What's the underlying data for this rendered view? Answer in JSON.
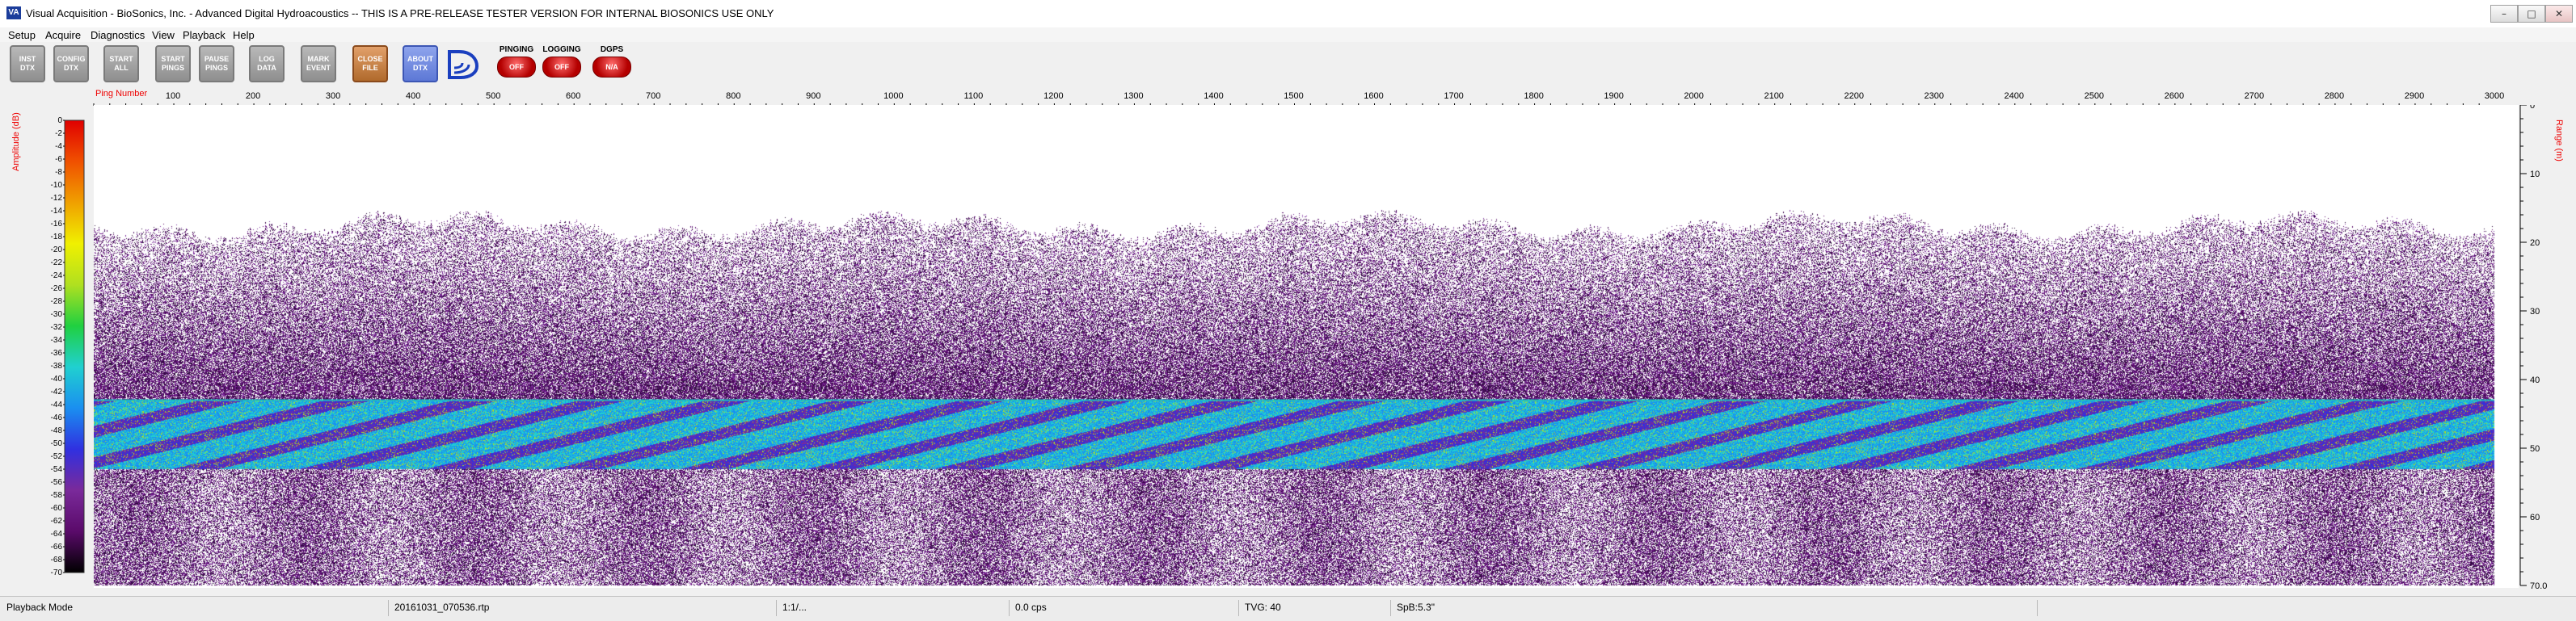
{
  "window": {
    "app_icon_text": "VA",
    "title": "Visual Acquisition  -  BioSonics, Inc.  -  Advanced Digital Hydroacoustics  --  THIS IS A PRE-RELEASE TESTER VERSION FOR INTERNAL BIOSONICS USE ONLY",
    "controls": {
      "minimize": "–",
      "maximize": "□",
      "close": "✕"
    }
  },
  "menu": {
    "items": [
      {
        "label": "Setup"
      },
      {
        "label": "Acquire"
      },
      {
        "label": "Diagnostics"
      },
      {
        "label": "View"
      },
      {
        "label": "Playback"
      },
      {
        "label": "Help"
      }
    ]
  },
  "toolbar": {
    "buttons": [
      {
        "label": "INST\nDTX",
        "style": "gray"
      },
      {
        "label": "CONFIG\nDTX",
        "style": "gray"
      },
      {
        "label": "START\nALL",
        "style": "gray"
      },
      {
        "label": "START\nPINGS",
        "style": "gray"
      },
      {
        "label": "PAUSE\nPINGS",
        "style": "gray"
      },
      {
        "label": "LOG\nDATA",
        "style": "gray"
      },
      {
        "label": "MARK\nEVENT",
        "style": "gray"
      },
      {
        "label": "CLOSE\nFILE",
        "style": "orange"
      },
      {
        "label": "ABOUT\nDTX",
        "style": "blue"
      }
    ],
    "logo_icon": "biosonics-logo-icon",
    "status": [
      {
        "label": "PINGING",
        "value": "OFF"
      },
      {
        "label": "LOGGING",
        "value": "OFF"
      },
      {
        "label": "DGPS",
        "value": "N/A"
      }
    ]
  },
  "axes": {
    "amplitude_title": "Amplitude (dB)",
    "range_title": "Range (m)",
    "ping_title": "Ping Number",
    "colorbar_ticks": [
      "0",
      "-2",
      "-4",
      "-6",
      "-8",
      "-10",
      "-12",
      "-14",
      "-16",
      "-18",
      "-20",
      "-22",
      "-24",
      "-26",
      "-28",
      "-30",
      "-32",
      "-34",
      "-36",
      "-38",
      "-40",
      "-42",
      "-44",
      "-46",
      "-48",
      "-50",
      "-52",
      "-54",
      "-56",
      "-58",
      "-60",
      "-62",
      "-64",
      "-66",
      "-68",
      "-70"
    ],
    "range_ticks": [
      "0",
      "10",
      "20",
      "30",
      "40",
      "50",
      "60",
      "70.0"
    ],
    "ping_ticks": [
      "100",
      "200",
      "300",
      "400",
      "500",
      "600",
      "700",
      "800",
      "900",
      "1000",
      "1100",
      "1200",
      "1300",
      "1400",
      "1500",
      "1600",
      "1700",
      "1800",
      "1900",
      "2000",
      "2100",
      "2200",
      "2300",
      "2400",
      "2500",
      "2600",
      "2700",
      "2800",
      "2900",
      "3000"
    ]
  },
  "chart_data": {
    "type": "heatmap",
    "x": {
      "label": "Ping Number",
      "range": [
        1,
        3000
      ]
    },
    "y": {
      "label": "Range (m)",
      "range": [
        0,
        70
      ]
    },
    "colorbar": {
      "label": "Amplitude (dB)",
      "range": [
        0,
        -70
      ]
    },
    "layers": [
      {
        "from_m": 0,
        "to_m": 17,
        "level": "none (blank)"
      },
      {
        "from_m": 17,
        "to_m": 43,
        "level": "sparse scatter around -65 dB"
      },
      {
        "from_m": 43,
        "to_m": 53,
        "level": "strong band -40 to -52 dB"
      },
      {
        "from_m": 53,
        "to_m": 70,
        "level": "scatter around -60 to -70 dB"
      }
    ]
  },
  "colors": {
    "colormap": [
      "#000000",
      "#5a0a6a",
      "#7a2a9a",
      "#3030e0",
      "#1a8ff0",
      "#20d0d0",
      "#20d040",
      "#b0e020",
      "#f0f000",
      "#f0a000",
      "#f05000",
      "#e00000"
    ],
    "axis_title": "#ee0000"
  },
  "statusbar": {
    "mode": "Playback Mode",
    "file": "20161031_070536.rtp",
    "ratio": "1:1/...",
    "cps": "0.0 cps",
    "tvg": "TVG: 40",
    "spb": "SpB:5.3\""
  }
}
